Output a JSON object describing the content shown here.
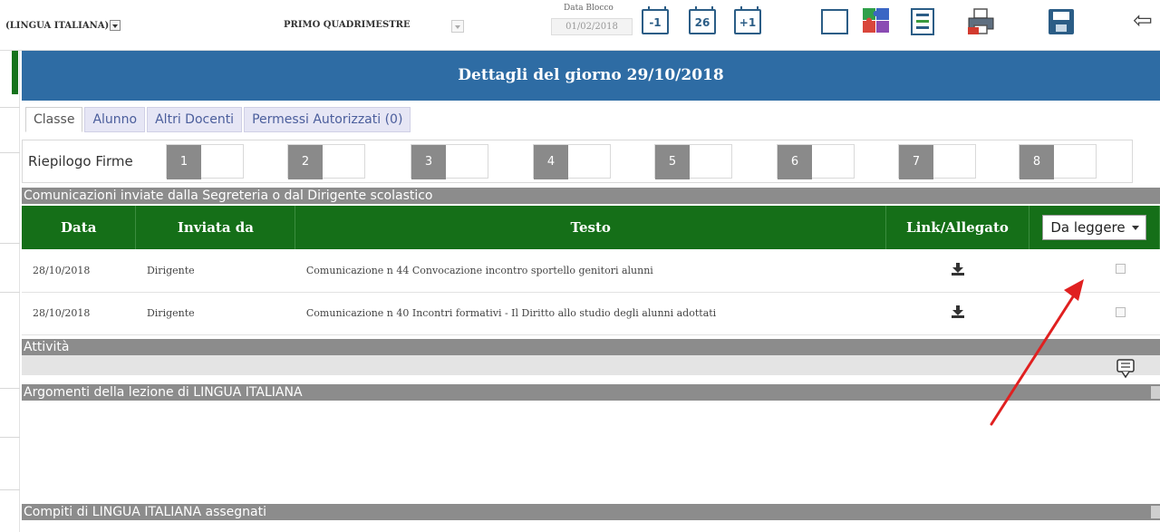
{
  "toolbar": {
    "subject": "(LINGUA ITALIANA)",
    "period": "PRIMO QUADRIMESTRE",
    "block_label": "Data Blocco",
    "block_date": "01/02/2018",
    "prev_day_label": "-1",
    "today_label": "26",
    "next_day_label": "+1",
    "back_glyph": "⇦"
  },
  "panel": {
    "title": "Dettagli del giorno 29/10/2018",
    "tabs": [
      {
        "label": "Classe",
        "active": true
      },
      {
        "label": "Alunno",
        "active": false
      },
      {
        "label": "Altri Docenti",
        "active": false
      },
      {
        "label": "Permessi Autorizzati (0)",
        "active": false
      }
    ],
    "firme": {
      "label": "Riepilogo Firme",
      "slots": [
        "1",
        "2",
        "3",
        "4",
        "5",
        "6",
        "7",
        "8"
      ]
    },
    "communications": {
      "section_title": "Comunicazioni inviate dalla Segreteria o dal Dirigente scolastico",
      "columns": [
        "Data",
        "Inviata da",
        "Testo",
        "Link/Allegato"
      ],
      "filter_label": "Da leggere",
      "rows": [
        {
          "date": "28/10/2018",
          "sender": "Dirigente",
          "text": "Comunicazione n 44 Convocazione incontro sportello genitori alunni"
        },
        {
          "date": "28/10/2018",
          "sender": "Dirigente",
          "text": "Comunicazione n 40 Incontri formativi - Il Diritto allo studio degli alunni adottati"
        }
      ]
    },
    "attivita_title": "Attività",
    "argomenti_title": "Argomenti della lezione di LINGUA ITALIANA",
    "compiti_title": "Compiti di LINGUA ITALIANA assegnati"
  },
  "colors": {
    "header_blue": "#2e6ca4",
    "table_green": "#156f18",
    "section_gray": "#8c8c8c",
    "annotation_red": "#e02020"
  },
  "icons": [
    "chevron-down-icon",
    "calendar-prev-icon",
    "calendar-today-icon",
    "calendar-next-icon",
    "view-icon",
    "puzzle-icon",
    "list-icon",
    "print-icon",
    "save-icon",
    "back-arrow-icon",
    "download-icon",
    "comment-icon",
    "annotation-arrow"
  ]
}
